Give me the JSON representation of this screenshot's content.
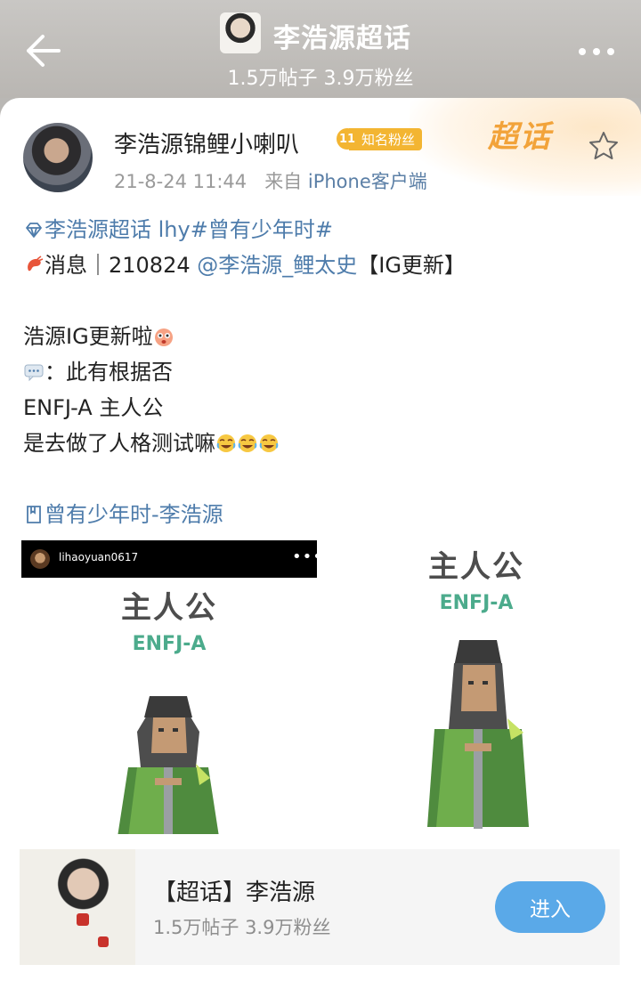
{
  "header": {
    "title": "李浩源超话",
    "stats": "1.5万帖子 3.9万粉丝"
  },
  "post": {
    "author": "李浩源锦鲤小喇叭",
    "badge_level": "11",
    "badge_label": "知名粉丝",
    "time": "21-8-24 11:44",
    "source_prefix": "来自",
    "source": "iPhone客户端",
    "supertopic_mark": "超话",
    "body": {
      "topic_link": "李浩源超话",
      "topic_tag_text": "lhy#曾有少年时#",
      "line2_prefix": "消息｜210824 ",
      "mention": "@李浩源_鲤太史",
      "line2_suffix": "【IG更新】",
      "line3": "浩源IG更新啦",
      "line4": "：此有根据否",
      "line5": "ENFJ-A 主人公",
      "line6": "是去做了人格测试嘛"
    },
    "topic_footer_link": "曾有少年时-李浩源"
  },
  "images": {
    "left": {
      "ig_username": "lihaoyuan0617",
      "ig_more": "•••",
      "persona_title": "主人公",
      "persona_code": "ENFJ-A"
    },
    "right": {
      "persona_title": "主人公",
      "persona_code": "ENFJ-A"
    }
  },
  "topic_bar": {
    "name": "【超话】李浩源",
    "stats": "1.5万帖子 3.9万粉丝",
    "enter_label": "进入"
  },
  "colors": {
    "link": "#4e7cab",
    "badge": "#f3b532",
    "accent_orange": "#f2a33a",
    "persona_green": "#4cab8c",
    "enter_button": "#5aa9e8"
  },
  "icons": [
    "back-arrow-icon",
    "more-dots-icon",
    "star-icon",
    "diamond-icon",
    "shrimp-icon",
    "sticker-icon",
    "speech-bubble-icon",
    "laugh-cry-emoji",
    "book-icon"
  ]
}
